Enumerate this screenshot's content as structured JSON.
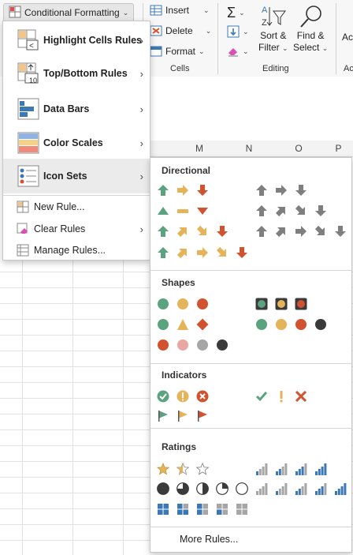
{
  "ribbon": {
    "cf_button": "Conditional Formatting",
    "insert": "Insert",
    "delete": "Delete",
    "format": "Format",
    "cells_group": "Cells",
    "sort_line1": "Sort &",
    "sort_line2": "Filter",
    "find_line1": "Find &",
    "find_line2": "Select",
    "editing_group": "Editing",
    "cut_off_label": "Ac"
  },
  "columns": [
    "M",
    "N",
    "O",
    "P"
  ],
  "cf_menu": {
    "items": [
      {
        "label": "Highlight Cells Rules"
      },
      {
        "label": "Top/Bottom Rules"
      },
      {
        "label": "Data Bars"
      },
      {
        "label": "Color Scales"
      },
      {
        "label": "Icon Sets"
      },
      {
        "label": "New Rule..."
      },
      {
        "label": "Clear Rules"
      },
      {
        "label": "Manage Rules..."
      }
    ]
  },
  "icon_sets_menu": {
    "directional": "Directional",
    "shapes": "Shapes",
    "indicators": "Indicators",
    "ratings": "Ratings",
    "more_rules": "More Rules...",
    "topbottom_badge": "10"
  },
  "colors": {
    "green": "#5aa37e",
    "yellow": "#e5b45a",
    "red": "#d1522f",
    "gray": "#7f7f7f",
    "black": "#3a3a3a",
    "pink": "#eaa6a3",
    "lightgray": "#a6a6a6",
    "blue": "#3b78b5",
    "signal_bg": "#3a3a3a"
  }
}
